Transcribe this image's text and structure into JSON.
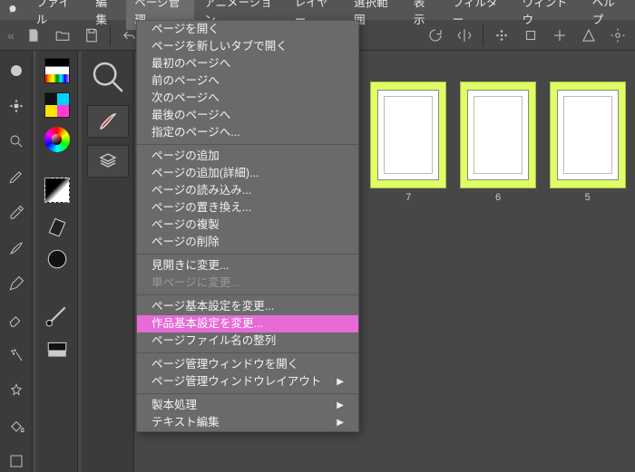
{
  "menubar": {
    "items": [
      {
        "label": "ファイル"
      },
      {
        "label": "編集"
      },
      {
        "label": "ページ管理",
        "active": true
      },
      {
        "label": "アニメーション"
      },
      {
        "label": "レイヤー"
      },
      {
        "label": "選択範囲"
      },
      {
        "label": "表示"
      },
      {
        "label": "フィルター"
      },
      {
        "label": "ウィンドウ"
      },
      {
        "label": "ヘルプ"
      }
    ]
  },
  "dropdown": {
    "groups": [
      [
        {
          "label": "ページを開く"
        },
        {
          "label": "ページを新しいタブで開く"
        },
        {
          "label": "最初のページへ"
        },
        {
          "label": "前のページへ"
        },
        {
          "label": "次のページへ"
        },
        {
          "label": "最後のページへ"
        },
        {
          "label": "指定のページへ..."
        }
      ],
      [
        {
          "label": "ページの追加"
        },
        {
          "label": "ページの追加(詳細)..."
        },
        {
          "label": "ページの読み込み..."
        },
        {
          "label": "ページの置き換え..."
        },
        {
          "label": "ページの複製"
        },
        {
          "label": "ページの削除"
        }
      ],
      [
        {
          "label": "見開きに変更..."
        },
        {
          "label": "単ページに変更...",
          "disabled": true
        }
      ],
      [
        {
          "label": "ページ基本設定を変更..."
        },
        {
          "label": "作品基本設定を変更...",
          "highlight": true
        },
        {
          "label": "ページファイル名の整列"
        }
      ],
      [
        {
          "label": "ページ管理ウィンドウを開く"
        },
        {
          "label": "ページ管理ウィンドウレイアウト",
          "submenu": true
        }
      ],
      [
        {
          "label": "製本処理",
          "submenu": true
        },
        {
          "label": "テキスト編集",
          "submenu": true
        }
      ]
    ]
  },
  "thumbs": [
    {
      "label": "7"
    },
    {
      "label": "6"
    },
    {
      "label": "5"
    }
  ]
}
